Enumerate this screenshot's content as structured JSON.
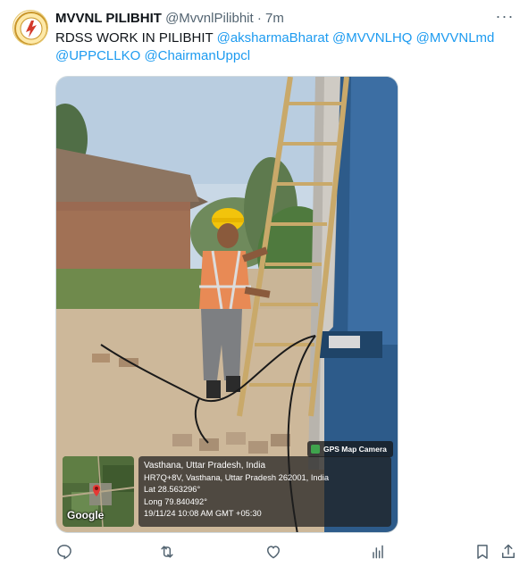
{
  "tweet": {
    "display_name": "MVVNL PILIBHIT",
    "handle": "@MvvnlPilibhit",
    "separator": "·",
    "time": "7m",
    "more_label": "···",
    "text_prefix": "RDSS WORK IN PILIBHIT",
    "mentions": [
      "@aksharmaBharat",
      "@MVVNLHQ",
      "@MVVNLmd",
      "@UPPCLLKO",
      "@ChairmanUppcl"
    ]
  },
  "media": {
    "badge": "GPS Map Camera",
    "map_label": "Google",
    "geo_lines": {
      "place": "Vasthana, Uttar Pradesh, India",
      "address": "HR7Q+8V, Vasthana, Uttar Pradesh 262001, India",
      "lat": "Lat 28.563296°",
      "long": "Long 79.840492°",
      "timestamp": "19/11/24 10:08 AM GMT +05:30"
    }
  },
  "actions": {
    "icons": [
      "reply-icon",
      "retweet-icon",
      "like-icon",
      "views-icon",
      "bookmark-icon",
      "share-icon"
    ]
  },
  "colors": {
    "link": "#1d9bf0",
    "muted": "#536471",
    "text": "#0f1419"
  }
}
